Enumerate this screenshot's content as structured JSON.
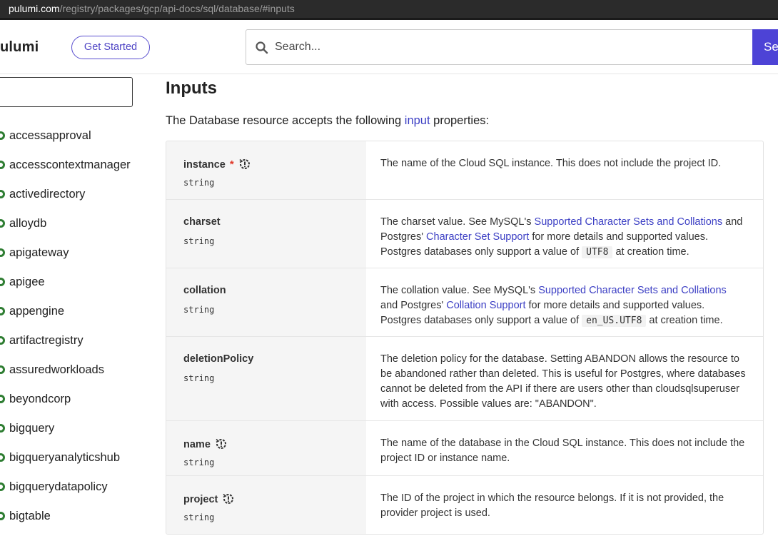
{
  "url": {
    "host": "pulumi.com",
    "path": "/registry/packages/gcp/api-docs/sql/database/#inputs"
  },
  "header": {
    "logo": "ulumi",
    "get_started": "Get Started",
    "search_placeholder": "Search...",
    "search_button": "Se"
  },
  "sidebar": {
    "filter_value": "",
    "items": [
      "accessapproval",
      "accesscontextmanager",
      "activedirectory",
      "alloydb",
      "apigateway",
      "apigee",
      "appengine",
      "artifactregistry",
      "assuredworkloads",
      "beyondcorp",
      "bigquery",
      "bigqueryanalyticshub",
      "bigquerydatapolicy",
      "bigtable"
    ]
  },
  "main": {
    "title": "Inputs",
    "intro_before": "The Database resource accepts the following ",
    "intro_link": "input",
    "intro_after": " properties:",
    "properties": [
      {
        "name": "instance",
        "type": "string",
        "required_mark": "*",
        "desc_parts": [
          "The name of the Cloud SQL instance. This does not include the project ID."
        ]
      },
      {
        "name": "charset",
        "type": "string",
        "desc_a": "The charset value. See MySQL's ",
        "link1": "Supported Character Sets and Collations",
        "desc_b": " and Postgres' ",
        "link2": "Character Set Support",
        "desc_c": " for more details and supported values. Postgres databases only support a value of ",
        "code": "UTF8",
        "desc_d": " at creation time."
      },
      {
        "name": "collation",
        "type": "string",
        "desc_a": "The collation value. See MySQL's ",
        "link1": "Supported Character Sets and Collations",
        "desc_b": " and Postgres' ",
        "link2": "Collation Support",
        "desc_c": " for more details and supported values. Postgres databases only support a value of ",
        "code": "en_US.UTF8",
        "desc_d": " at creation time."
      },
      {
        "name": "deletionPolicy",
        "type": "string",
        "desc": "The deletion policy for the database. Setting ABANDON allows the resource to be abandoned rather than deleted. This is useful for Postgres, where databases cannot be deleted from the API if there are users other than cloudsqlsuperuser with access. Possible values are: \"ABANDON\"."
      },
      {
        "name": "name",
        "type": "string",
        "desc": "The name of the database in the Cloud SQL instance. This does not include the project ID or instance name."
      },
      {
        "name": "project",
        "type": "string",
        "desc": "The ID of the project in which the resource belongs. If it is not provided, the provider project is used."
      }
    ]
  }
}
